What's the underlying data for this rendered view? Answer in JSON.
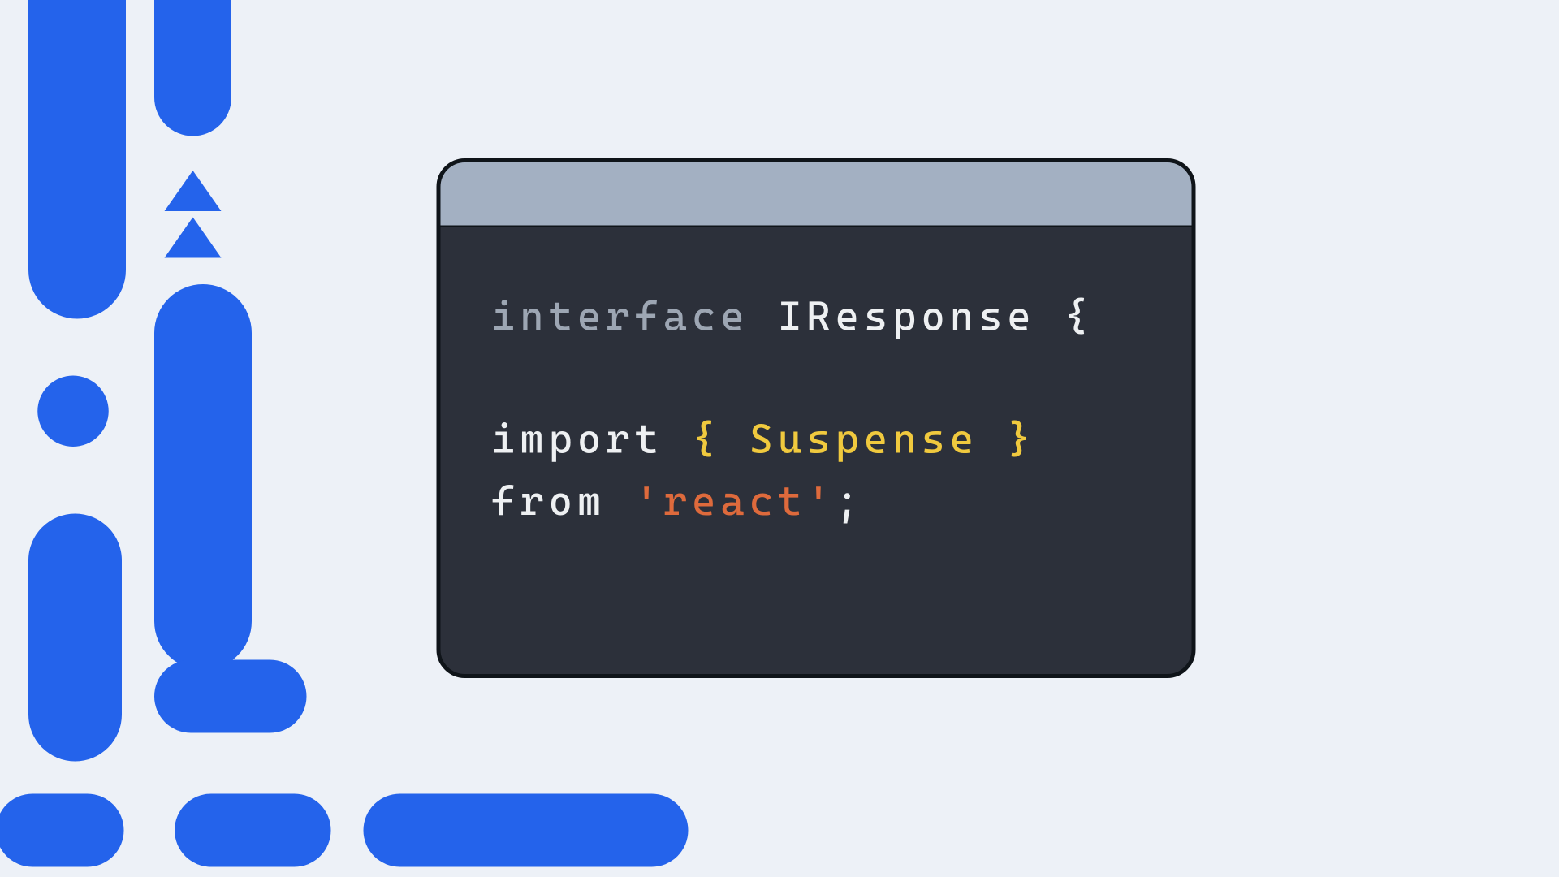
{
  "colors": {
    "bg": "#edf1f7",
    "accent": "#2463eb",
    "window_border": "#0f1419",
    "titlebar": "#a3b0c2",
    "code_bg": "#2c303a"
  },
  "code": {
    "line1": {
      "keyword": "interface",
      "identifier": "IResponse",
      "brace": "{"
    },
    "line3": {
      "keyword": "import",
      "brace_open": "{",
      "name": "Suspense",
      "brace_close": "}"
    },
    "line4": {
      "keyword": "from",
      "string": "'react'",
      "semi": ";"
    }
  }
}
